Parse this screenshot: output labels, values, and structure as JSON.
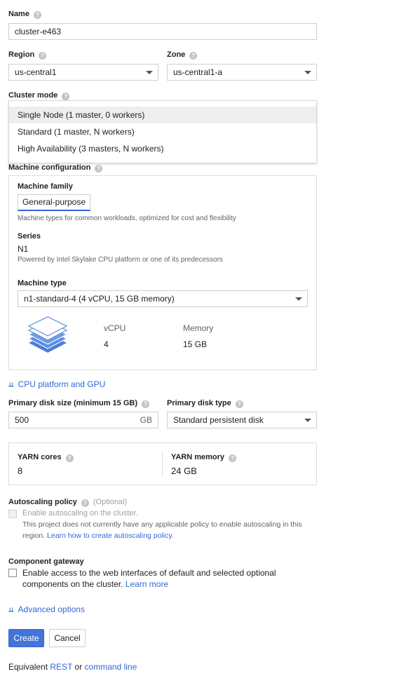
{
  "name": {
    "label": "Name",
    "value": "cluster-e463"
  },
  "region": {
    "label": "Region",
    "value": "us-central1"
  },
  "zone": {
    "label": "Zone",
    "value": "us-central1-a"
  },
  "cluster_mode": {
    "label": "Cluster mode",
    "options": [
      "Single Node (1 master, 0 workers)",
      "Standard (1 master, N workers)",
      "High Availability (3 masters, N workers)"
    ]
  },
  "machine_config": {
    "label": "Machine configuration",
    "family_label": "Machine family",
    "family_tab": "General-purpose",
    "family_desc": "Machine types for common workloads, optimized for cost and flexibility",
    "series_label": "Series",
    "series_value": "N1",
    "series_desc": "Powered by Intel Skylake CPU platform or one of its predecessors",
    "type_label": "Machine type",
    "type_value": "n1-standard-4 (4 vCPU, 15 GB memory)",
    "vcpu_label": "vCPU",
    "vcpu_value": "4",
    "memory_label": "Memory",
    "memory_value": "15 GB"
  },
  "cpu_gpu_link": "CPU platform and GPU",
  "disk": {
    "size_label": "Primary disk size (minimum 15 GB)",
    "size_value": "500",
    "size_unit": "GB",
    "type_label": "Primary disk type",
    "type_value": "Standard persistent disk"
  },
  "yarn": {
    "cores_label": "YARN cores",
    "cores_value": "8",
    "memory_label": "YARN memory",
    "memory_value": "24 GB"
  },
  "autoscaling": {
    "label": "Autoscaling policy",
    "optional": "(Optional)",
    "checkbox_label": "Enable autoscaling on the cluster.",
    "note_line1": "This project does not currently have any applicable policy to enable autoscaling in this",
    "note_line2_prefix": "region.",
    "note_link": "Learn how to create autoscaling policy."
  },
  "component_gateway": {
    "label": "Component gateway",
    "line1": "Enable access to the web interfaces of default and selected optional",
    "line2_prefix": "components on the cluster.",
    "link": "Learn more"
  },
  "advanced_options": "Advanced options",
  "buttons": {
    "create": "Create",
    "cancel": "Cancel"
  },
  "footer": {
    "prefix": "Equivalent",
    "rest": "REST",
    "or": "or",
    "command_line": "command line"
  },
  "icons": {
    "help": "help-icon",
    "dropdown": "dropdown-caret-icon",
    "expand": "chevron-double-down-icon",
    "machine": "stacked-layers-icon"
  },
  "colors": {
    "accent": "#3367d6",
    "primary_button": "#4374d8",
    "icon_blue": "#5b8ee0"
  }
}
